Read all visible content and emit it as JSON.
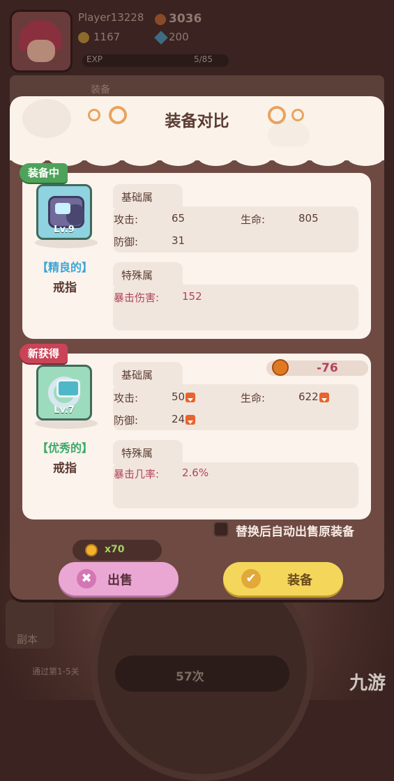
{
  "background": {
    "player_name": "Player13228",
    "gold": "3036",
    "coins": "1167",
    "gems": "200",
    "exp_label": "EXP",
    "exp_value": "5/85",
    "tab_title": "装备",
    "side_label": "副本",
    "stage_text": "通过第1-5关",
    "count_text": "57次",
    "watermark": "九游"
  },
  "dialog": {
    "title": "装备对比",
    "current": {
      "badge": "装备中",
      "level": "Lv.9",
      "quality": "【精良的】",
      "name": "戒指",
      "basic_title": "基础属",
      "attack_label": "攻击:",
      "attack_value": "65",
      "hp_label": "生命:",
      "hp_value": "805",
      "defense_label": "防御:",
      "defense_value": "31",
      "special_title": "特殊属",
      "special_label": "暴击伤害:",
      "special_value": "152"
    },
    "new": {
      "badge": "新获得",
      "level": "Lv.7",
      "quality": "【优秀的】",
      "name": "戒指",
      "basic_title": "基础属",
      "power_diff": "-76",
      "attack_label": "攻击:",
      "attack_value": "50",
      "hp_label": "生命:",
      "hp_value": "622",
      "defense_label": "防御:",
      "defense_value": "24",
      "special_title": "特殊属",
      "special_label": "暴击几率:",
      "special_value": "2.6%"
    },
    "auto_sell_label": "替换后自动出售原装备",
    "price": "x70",
    "sell_label": "出售",
    "equip_label": "装备"
  }
}
